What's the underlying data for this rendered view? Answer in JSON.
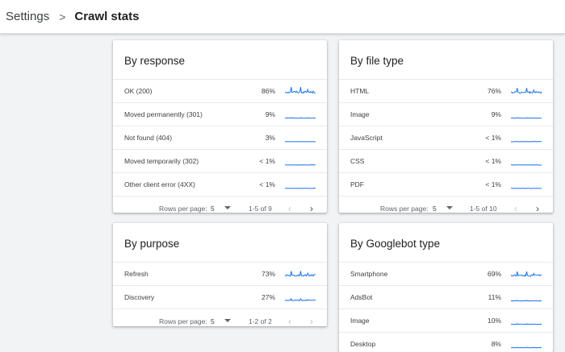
{
  "breadcrumb": {
    "root": "Settings",
    "separator": ">",
    "current": "Crawl stats"
  },
  "colors": {
    "spark": "#1a73e8"
  },
  "cards": {
    "response": {
      "title": "By response",
      "rows": [
        {
          "label": "OK (200)",
          "pct": "86%",
          "level": 0.86
        },
        {
          "label": "Moved permanently (301)",
          "pct": "9%",
          "level": 0.09
        },
        {
          "label": "Not found (404)",
          "pct": "3%",
          "level": 0.03
        },
        {
          "label": "Moved temporarily (302)",
          "pct": "< 1%",
          "level": 0.0
        },
        {
          "label": "Other client error (4XX)",
          "pct": "< 1%",
          "level": 0.0
        }
      ],
      "footer": {
        "rows_per_page_label": "Rows per page:",
        "rows_per_page": "5",
        "range": "1-5 of 9",
        "prev": "‹",
        "next": "›"
      }
    },
    "filetype": {
      "title": "By file type",
      "rows": [
        {
          "label": "HTML",
          "pct": "76%",
          "level": 0.76
        },
        {
          "label": "Image",
          "pct": "9%",
          "level": 0.09
        },
        {
          "label": "JavaScript",
          "pct": "< 1%",
          "level": 0.0
        },
        {
          "label": "CSS",
          "pct": "< 1%",
          "level": 0.0
        },
        {
          "label": "PDF",
          "pct": "< 1%",
          "level": 0.0
        }
      ],
      "footer": {
        "rows_per_page_label": "Rows per page:",
        "rows_per_page": "5",
        "range": "1-5 of 10",
        "prev": "‹",
        "next": "›"
      }
    },
    "purpose": {
      "title": "By purpose",
      "rows": [
        {
          "label": "Refresh",
          "pct": "73%",
          "level": 0.73
        },
        {
          "label": "Discovery",
          "pct": "27%",
          "level": 0.27
        }
      ],
      "footer": {
        "rows_per_page_label": "Rows per page:",
        "rows_per_page": "5",
        "range": "1-2 of 2",
        "prev": "‹",
        "next": "›"
      }
    },
    "googlebot": {
      "title": "By Googlebot type",
      "rows": [
        {
          "label": "Smartphone",
          "pct": "69%",
          "level": 0.69
        },
        {
          "label": "AdsBot",
          "pct": "11%",
          "level": 0.11
        },
        {
          "label": "Image",
          "pct": "10%",
          "level": 0.1
        },
        {
          "label": "Desktop",
          "pct": "8%",
          "level": 0.08
        }
      ]
    }
  }
}
